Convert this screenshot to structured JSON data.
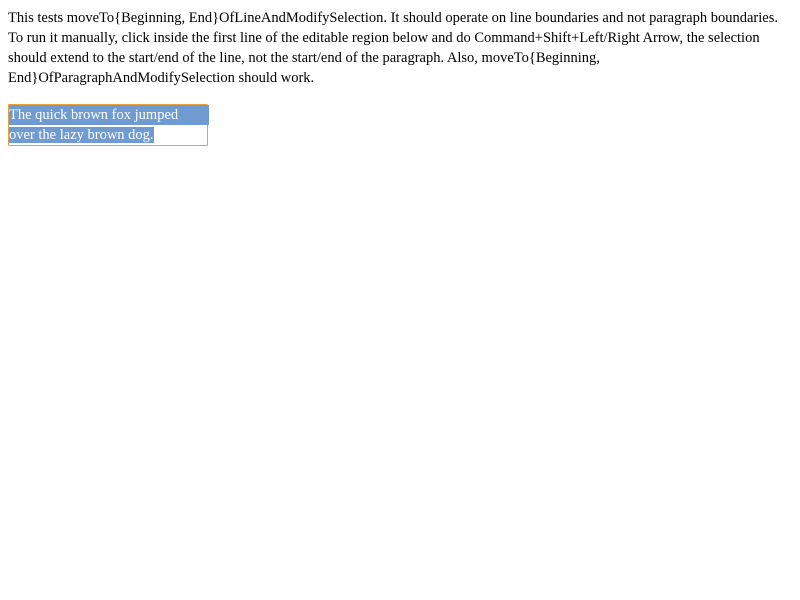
{
  "description": "This tests moveTo{Beginning, End}OfLineAndModifySelection. It should operate on line boundaries and not paragraph boundaries. To run it manually, click inside the first line of the editable region below and do Command+Shift+Left/Right Arrow, the selection should extend to the start/end of the line, not the start/end of the paragraph. Also, moveTo{Beginning, End}OfParagraphAndModifySelection should work.",
  "editable": {
    "line1": "The quick brown fox jumped",
    "line2": "over the lazy brown dog."
  },
  "colors": {
    "selection": "#6f9bd1",
    "focus_border": "#e8a23a"
  }
}
